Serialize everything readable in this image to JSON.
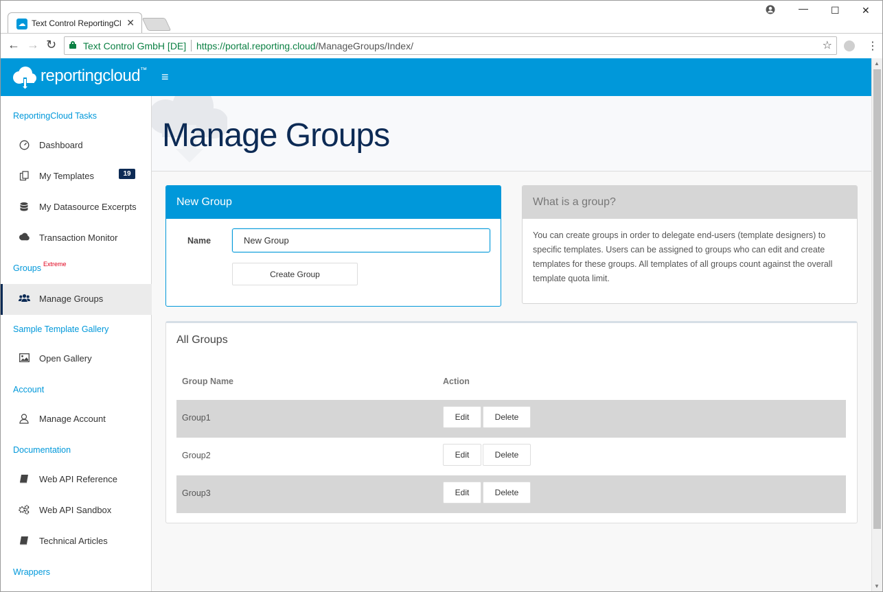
{
  "browser": {
    "tab_title": "Text Control ReportingCl",
    "org": "Text Control GmbH [DE]",
    "url_host": "https://portal.reporting.cloud",
    "url_path": "/ManageGroups/Index/"
  },
  "header": {
    "logo_text": "reportingcloud",
    "logo_tm": "™"
  },
  "sidebar": {
    "sections": {
      "tasks": "ReportingCloud Tasks",
      "groups": "Groups",
      "groups_sup": "Extreme",
      "gallery": "Sample Template Gallery",
      "account": "Account",
      "docs": "Documentation",
      "wrappers": "Wrappers"
    },
    "items": {
      "dashboard": "Dashboard",
      "templates": "My Templates",
      "templates_count": "19",
      "datasource": "My Datasource Excerpts",
      "transaction": "Transaction Monitor",
      "manage_groups": "Manage Groups",
      "open_gallery": "Open Gallery",
      "manage_account": "Manage Account",
      "web_api_ref": "Web API Reference",
      "web_api_sandbox": "Web API Sandbox",
      "tech_articles": "Technical Articles"
    }
  },
  "main": {
    "title": "Manage Groups",
    "new_group": {
      "heading": "New Group",
      "name_label": "Name",
      "name_value": "New Group",
      "create_label": "Create Group"
    },
    "what": {
      "heading": "What is a group?",
      "text": "You can create groups in order to delegate end-users (template designers) to specific templates. Users can be assigned to groups who can edit and create templates for these groups. All templates of all groups count against the overall template quota limit."
    },
    "all_groups": {
      "heading": "All Groups",
      "col_name": "Group Name",
      "col_action": "Action",
      "edit_label": "Edit",
      "delete_label": "Delete",
      "rows": [
        "Group1",
        "Group2",
        "Group3"
      ]
    }
  },
  "colors": {
    "accent": "#0098da",
    "navy": "#0d2b55"
  }
}
